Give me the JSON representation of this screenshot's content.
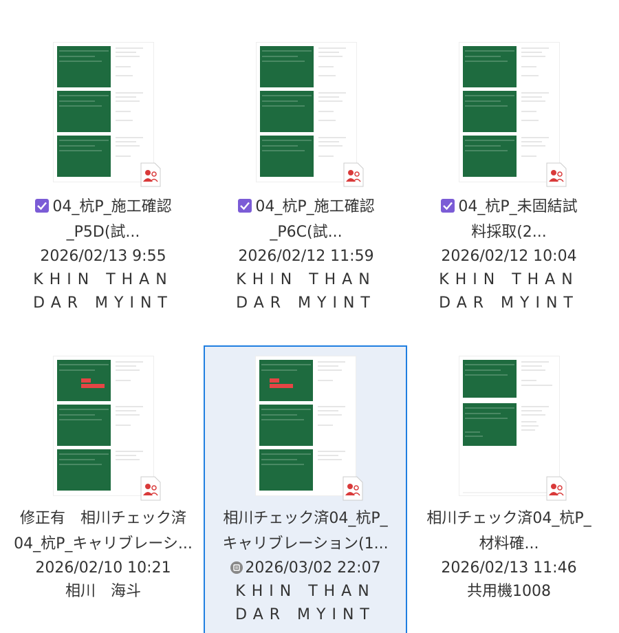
{
  "files": [
    {
      "name_lines": [
        "04_杭P_施工確認",
        "_P5D(試..."
      ],
      "checked": true,
      "date": "2026/02/13 9:55",
      "owner_lines": [
        "KHIN THAN",
        "DAR MYINT"
      ],
      "spaced_owner": true
    },
    {
      "name_lines": [
        "04_杭P_施工確認",
        "_P6C(試..."
      ],
      "checked": true,
      "date": "2026/02/12 11:59",
      "owner_lines": [
        "KHIN THAN",
        "DAR MYINT"
      ],
      "spaced_owner": true
    },
    {
      "name_lines": [
        "04_杭P_未固結試",
        "料採取(2..."
      ],
      "checked": true,
      "date": "2026/02/12 10:04",
      "owner_lines": [
        "KHIN THAN",
        "DAR MYINT"
      ],
      "spaced_owner": true
    },
    {
      "name_lines": [
        "修正有　相川チェック済",
        "04_杭P_キャリブレーシ..."
      ],
      "checked": false,
      "date": "2026/02/10 10:21",
      "owner_lines": [
        "相川　海斗"
      ],
      "spaced_owner": false
    },
    {
      "name_lines": [
        "相川チェック済04_杭P_",
        "キャリブレーション(1..."
      ],
      "checked": false,
      "date": "2026/03/02 22:07",
      "owner_lines": [
        "KHIN THAN",
        "DAR MYINT"
      ],
      "spaced_owner": true,
      "selected": true,
      "cloud_status": true
    },
    {
      "name_lines": [
        "相川チェック済04_杭P_",
        "材料確..."
      ],
      "checked": false,
      "date": "2026/02/13 11:46",
      "owner_lines": [
        "共用機1008"
      ],
      "spaced_owner": false
    }
  ],
  "colors": {
    "board_green": "#1e6b3f",
    "check_purple": "#7b5cd6",
    "pdf_red": "#d93a3a",
    "selection_border": "#1f7ee0",
    "selection_bg": "#e9eff8"
  },
  "icons": {
    "checkbox": "checkbox-checked-icon",
    "pdf": "pdf-shared-icon",
    "cloud": "cloud-sync-icon"
  }
}
